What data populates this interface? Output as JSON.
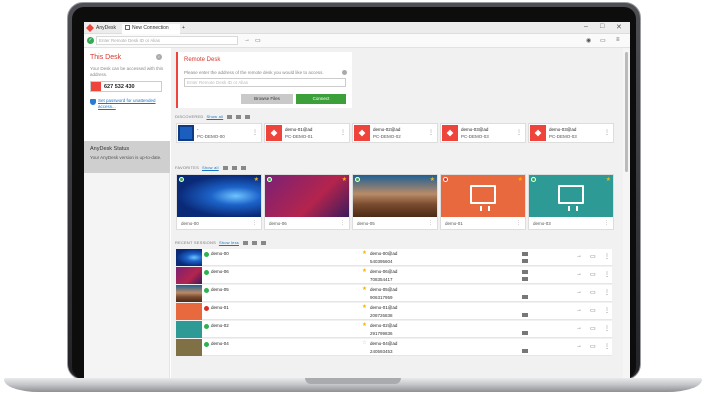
{
  "app": {
    "tab_main": "AnyDesk",
    "tab_new": "New Connection",
    "tab_add": "+",
    "window_controls": [
      "–",
      "□",
      "✕"
    ]
  },
  "address": {
    "placeholder": "Enter Remote Desk ID or Alias"
  },
  "this_desk": {
    "title": "This Desk",
    "description": "Your Desk can be accessed with this address.",
    "id": "627 532 430",
    "password_link": "Set password for unattended access..."
  },
  "status": {
    "title": "AnyDesk Status",
    "text": "Your AnyDesk version is up-to-date."
  },
  "remote": {
    "title": "Remote Desk",
    "text": "Please enter the address of the remote desk you would like to access.",
    "placeholder": "Enter Remote Desk ID or Alias",
    "browse_label": "Browse Files",
    "connect_label": "Connect"
  },
  "discovered": {
    "label": "DISCOVERED",
    "show_all": "Show all",
    "items": [
      {
        "name": "-",
        "id": "PC-DEMO-00",
        "thumb": "win"
      },
      {
        "name": "demo-01@ad",
        "id": "PC-DEMO-01",
        "thumb": "red"
      },
      {
        "name": "demo-02@ad",
        "id": "PC-DEMO-02",
        "thumb": "red"
      },
      {
        "name": "demo-03@ad",
        "id": "PC-DEMO-03",
        "thumb": "red"
      },
      {
        "name": "demo-03@ad",
        "id": "PC-DEMO-03",
        "thumb": "red"
      }
    ]
  },
  "favorites": {
    "label": "FAVORITES",
    "show_all": "Show all",
    "items": [
      {
        "name": "demo-00",
        "bg": "win"
      },
      {
        "name": "demo-06",
        "bg": "purple"
      },
      {
        "name": "demo-05",
        "bg": "desert"
      },
      {
        "name": "demo-01",
        "bg": "orange"
      },
      {
        "name": "demo-03",
        "bg": "teal"
      }
    ]
  },
  "recent": {
    "label": "RECENT SESSIONS",
    "show_all": "Show less",
    "rows": [
      {
        "name": "demo-00",
        "alias": "demo-00@ad",
        "id": "540395604",
        "bg": "win"
      },
      {
        "name": "demo-06",
        "alias": "demo-06@ad",
        "id": "708354417",
        "bg": "purple"
      },
      {
        "name": "demo-05",
        "alias": "demo-05@ad",
        "id": "906317959",
        "bg": "desert"
      },
      {
        "name": "demo-01",
        "alias": "demo-01@ad",
        "id": "208726838",
        "bg": "orange"
      },
      {
        "name": "demo-02",
        "alias": "demo-02@ad",
        "id": "291799836",
        "bg": "teal"
      },
      {
        "name": "demo-04",
        "alias": "demo-04@ad",
        "id": "240593453",
        "bg": "olive"
      }
    ]
  },
  "colors": {
    "brand": "#ef443b",
    "connect": "#3ba03a",
    "link": "#1a73c8"
  },
  "icons": [
    "anydesk-logo-icon",
    "check-icon",
    "arrow-right-icon",
    "file-icon",
    "settings-icon",
    "star-icon",
    "monitor-icon",
    "shield-icon",
    "info-icon",
    "menu-dots-icon"
  ]
}
